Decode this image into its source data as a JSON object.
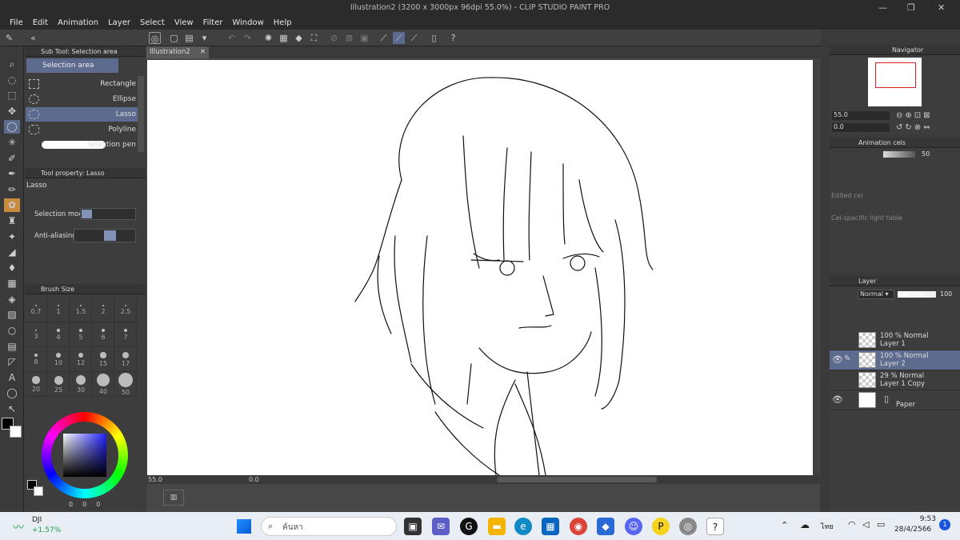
{
  "app": {
    "title": "Illustration2 (3200 x 3000px 96dpi 55.0%)  - CLIP STUDIO PAINT PRO",
    "window_controls": [
      "—",
      "❐",
      "✕"
    ]
  },
  "menu": [
    "File",
    "Edit",
    "Animation",
    "Layer",
    "Select",
    "View",
    "Filter",
    "Window",
    "Help"
  ],
  "subtool": {
    "header": "Sub Tool: Selection area",
    "group": "Selection area",
    "items": [
      {
        "label": "Rectangle",
        "selected": false
      },
      {
        "label": "Ellipse",
        "selected": false
      },
      {
        "label": "Lasso",
        "selected": true
      },
      {
        "label": "Polyline",
        "selected": false
      },
      {
        "label": "Selection pen",
        "selected": false
      }
    ]
  },
  "tool_property": {
    "header": "Tool property: Lasso",
    "name": "Lasso",
    "selection_mode_label": "Selection mode",
    "anti_aliasing_label": "Anti-aliasing"
  },
  "brush_size": {
    "header": "Brush Size",
    "sizes": [
      "0.7",
      "1",
      "1.5",
      "2",
      "2.5",
      "3",
      "4",
      "5",
      "6",
      "7",
      "8",
      "10",
      "12",
      "15",
      "17",
      "20",
      "25",
      "30",
      "40",
      "50"
    ]
  },
  "color": {
    "main": "#000000",
    "sub": "#ffffff",
    "r": "0",
    "g": "0",
    "b": "0"
  },
  "document": {
    "tab_label": "Illustration2",
    "zoom": "55.0",
    "angle": "0.0"
  },
  "navigator": {
    "header": "Navigator",
    "zoom": "55.0",
    "angle": "0.0"
  },
  "animation_cels": {
    "header": "Animation cels",
    "opacity": "50",
    "edited_cel": "Edited cel",
    "light_table": "Cel-specific light table"
  },
  "layer_panel": {
    "header": "Layer",
    "blend_mode": "Normal",
    "opacity": "100",
    "layers": [
      {
        "mode": "100 % Normal",
        "name": "Layer 1",
        "visible": false,
        "selected": false,
        "editing": false
      },
      {
        "mode": "100 % Normal",
        "name": "Layer 2",
        "visible": true,
        "selected": true,
        "editing": true
      },
      {
        "mode": "29 % Normal",
        "name": "Layer 1 Copy",
        "visible": false,
        "selected": false,
        "editing": false
      },
      {
        "mode": "",
        "name": "Paper",
        "visible": true,
        "selected": false,
        "editing": false
      }
    ]
  },
  "taskbar": {
    "widget_name": "DJI",
    "widget_value": "+1.57%",
    "search_placeholder": "ค้นหา",
    "language": "ไทย",
    "time": "9:53",
    "date": "28/4/2566",
    "notifications": "1",
    "accent": "#16a34a"
  }
}
